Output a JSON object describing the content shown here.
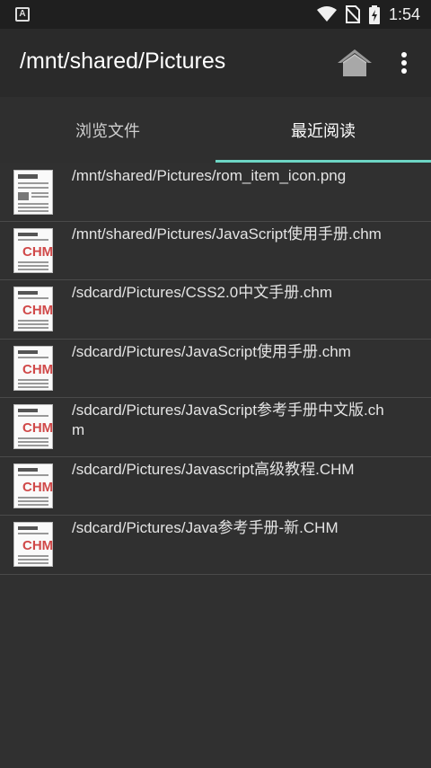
{
  "status_bar": {
    "time": "1:54",
    "left_icon_letter": "A",
    "icons": [
      "wifi-icon",
      "no-sim-icon",
      "battery-icon"
    ]
  },
  "app_bar": {
    "title": "/mnt/shared/Pictures",
    "actions": [
      "home-icon",
      "more-vert-icon"
    ]
  },
  "tabs": [
    {
      "label": "浏览文件",
      "selected": false
    },
    {
      "label": "最近阅读",
      "selected": true
    }
  ],
  "accent_color": "#6dd5c4",
  "recent_files": [
    {
      "path": "/mnt/shared/Pictures/rom_item_icon.png",
      "icon": "document-icon"
    },
    {
      "path": "/mnt/shared/Pictures/JavaScript使用手册.chm",
      "icon": "chm-file-icon",
      "icon_label": "CHM"
    },
    {
      "path": "/sdcard/Pictures/CSS2.0中文手册.chm",
      "icon": "chm-file-icon",
      "icon_label": "CHM"
    },
    {
      "path": "/sdcard/Pictures/JavaScript使用手册.chm",
      "icon": "chm-file-icon",
      "icon_label": "CHM"
    },
    {
      "path": "/sdcard/Pictures/JavaScript参考手册中文版.chm",
      "icon": "chm-file-icon",
      "icon_label": "CHM"
    },
    {
      "path": "/sdcard/Pictures/Javascript高级教程.CHM",
      "icon": "chm-file-icon",
      "icon_label": "CHM"
    },
    {
      "path": "/sdcard/Pictures/Java参考手册-新.CHM",
      "icon": "chm-file-icon",
      "icon_label": "CHM"
    }
  ]
}
